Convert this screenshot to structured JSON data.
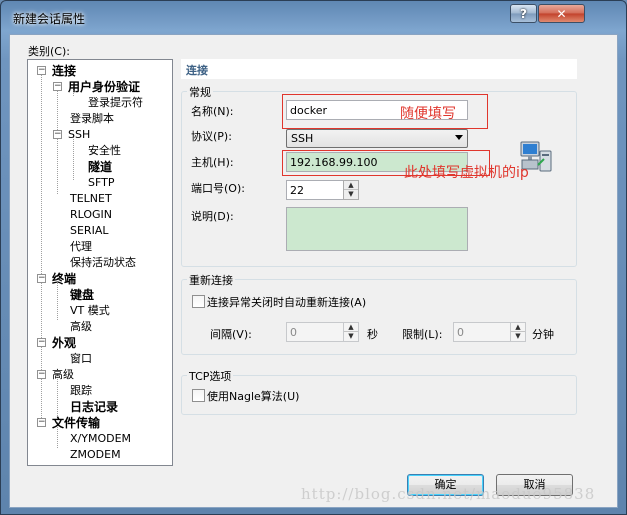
{
  "window": {
    "title": "新建会话属性",
    "help": "?",
    "close": "✕"
  },
  "category_label": "类别(C):",
  "tree": {
    "lianjie": "连接",
    "auth": "用户身份验证",
    "login_prompt": "登录提示符",
    "login_script": "登录脚本",
    "ssh": "SSH",
    "security": "安全性",
    "tunnel": "隧道",
    "sftp": "SFTP",
    "telnet": "TELNET",
    "rlogin": "RLOGIN",
    "serial": "SERIAL",
    "proxy": "代理",
    "keepalive": "保持活动状态",
    "terminal": "终端",
    "keyboard": "键盘",
    "vt_mode": "VT 模式",
    "advanced1": "高级",
    "appearance": "外观",
    "window": "窗口",
    "advanced2": "高级",
    "trace": "跟踪",
    "log": "日志记录",
    "file_transfer": "文件传输",
    "xymodem": "X/YMODEM",
    "zmodem": "ZMODEM",
    "expand_minus": "−"
  },
  "panel": {
    "title": "连接",
    "general": {
      "title": "常规",
      "name_label": "名称(N):",
      "name_value": "docker",
      "protocol_label": "协议(P):",
      "protocol_value": "SSH",
      "host_label": "主机(H):",
      "host_value": "192.168.99.100",
      "port_label": "端口号(O):",
      "port_value": "22",
      "desc_label": "说明(D):"
    },
    "reconnect": {
      "title": "重新连接",
      "checkbox_label": "连接异常关闭时自动重新连接(A)",
      "interval_label": "间隔(V):",
      "interval_value": "0",
      "interval_unit": "秒",
      "limit_label": "限制(L):",
      "limit_value": "0",
      "limit_unit": "分钟"
    },
    "tcp": {
      "title": "TCP选项",
      "nagle_label": "使用Nagle算法(U)"
    }
  },
  "buttons": {
    "ok": "确定",
    "cancel": "取消"
  },
  "annotations": {
    "name_note": "随便填写",
    "host_note": "此处填写虚拟机的ip"
  },
  "watermark": "http://blog.csdn.net/maoduo95838",
  "colors": {
    "annotation": "#e0362d",
    "desc_bg": "#cce8cf",
    "panel_title": "#3d6185"
  }
}
